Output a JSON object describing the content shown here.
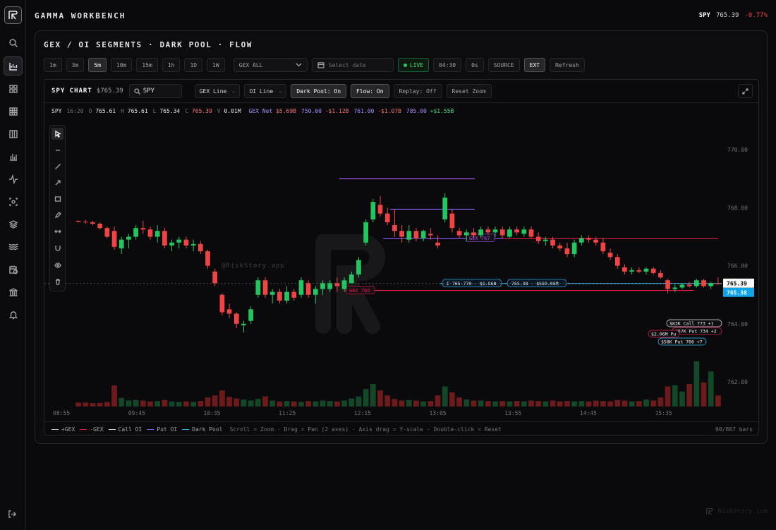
{
  "app": {
    "title": "GAMMA WORKBENCH"
  },
  "header_ticker": {
    "symbol": "SPY",
    "price": "765.39",
    "change": "-0.77%"
  },
  "panel": {
    "title": "GEX / OI SEGMENTS · DARK POOL · FLOW",
    "timeframes": [
      "1m",
      "3m",
      "5m",
      "10m",
      "15m",
      "1h",
      "1D",
      "1W"
    ],
    "active_timeframe": "5m",
    "gex_select": "GEX ALL",
    "date_placeholder": "Select date",
    "live_label": "LIVE",
    "clock": "04:30",
    "delay": "0s",
    "source_label": "SOURCE",
    "ext_label": "EXT",
    "refresh_label": "Refresh"
  },
  "chart_header": {
    "title": "SPY CHART",
    "price": "$765.39",
    "symbol_input": "SPY",
    "gex_mode": "GEX Line",
    "oi_mode": "OI  Line",
    "dark_pool": "Dark Pool: On",
    "flow": "Flow: On",
    "replay": "Replay: Off",
    "reset_zoom": "Reset Zoom"
  },
  "ohlc": {
    "symbol": "SPY",
    "time": "16:20",
    "o_label": "O",
    "o": "765.61",
    "h_label": "H",
    "h": "765.61",
    "l_label": "L",
    "l": "765.34",
    "c_label": "C",
    "c": "765.39",
    "v_label": "V",
    "v": "0.01M",
    "gex_label": "GEX Net",
    "gex_net": "$5.69B",
    "g1_strike": "750.00",
    "g1_val": "-$1.12B",
    "g2_strike": "761.00",
    "g2_val": "-$1.07B",
    "g3_strike": "785.00",
    "g3_val": "+$1.55B"
  },
  "watermark": "@RiskStory.app",
  "legend": {
    "items": [
      {
        "label": "+GEX",
        "color": "#d4d4d8"
      },
      {
        "label": "-GEX",
        "color": "#e11d48"
      },
      {
        "label": "Call OI",
        "color": "#e4e4e7"
      },
      {
        "label": "Put OI",
        "color": "#8b5cf6"
      },
      {
        "label": "Dark Pool",
        "color": "#38bdf8"
      }
    ],
    "hint": "Scroll = Zoom · Drag = Pan (2 axes) · Axis drag = Y-scale · Double-click = Reset",
    "bar_count": "90/887 bars"
  },
  "footer_brand": "RiskStory.com",
  "colors": {
    "up": "#22c55e",
    "down": "#ef4444",
    "gex_neg": "#e11d48",
    "put_oi": "#8b5cf6",
    "dark_pool": "#38bdf8"
  },
  "chart_data": {
    "type": "candlestick",
    "symbol": "SPY",
    "ylim": [
      761.2,
      771.0
    ],
    "y_ticks": [
      "770.00",
      "768.00",
      "766.00",
      "764.00",
      "762.00"
    ],
    "x_ticks": [
      "08:55",
      "09:45",
      "10:35",
      "11:25",
      "12:15",
      "13:05",
      "13:55",
      "14:45",
      "15:35"
    ],
    "candles": [
      [
        767.55,
        767.55,
        767.5,
        767.52
      ],
      [
        767.52,
        767.58,
        767.45,
        767.5
      ],
      [
        767.5,
        767.55,
        767.4,
        767.45
      ],
      [
        767.45,
        767.5,
        767.25,
        767.3
      ],
      [
        767.3,
        767.35,
        766.95,
        767.0
      ],
      [
        767.2,
        767.35,
        766.55,
        766.65
      ],
      [
        766.6,
        767.0,
        766.4,
        766.9
      ],
      [
        766.9,
        767.1,
        766.6,
        767.0
      ],
      [
        767.0,
        767.4,
        766.9,
        767.3
      ],
      [
        767.3,
        767.55,
        767.1,
        767.25
      ],
      [
        767.25,
        767.35,
        766.9,
        767.0
      ],
      [
        767.0,
        767.4,
        766.8,
        767.2
      ],
      [
        767.2,
        767.3,
        766.6,
        766.7
      ],
      [
        766.7,
        766.9,
        766.5,
        766.8
      ],
      [
        766.8,
        767.0,
        766.6,
        766.9
      ],
      [
        766.9,
        767.0,
        766.6,
        766.7
      ],
      [
        766.7,
        766.9,
        766.5,
        766.75
      ],
      [
        766.75,
        766.85,
        766.4,
        766.5
      ],
      [
        766.5,
        766.55,
        765.9,
        766.0
      ],
      [
        765.8,
        765.9,
        765.3,
        765.4
      ],
      [
        765.0,
        765.05,
        764.3,
        764.4
      ],
      [
        764.5,
        764.7,
        764.2,
        764.35
      ],
      [
        764.35,
        764.4,
        763.85,
        764.0
      ],
      [
        763.95,
        764.1,
        763.7,
        764.0
      ],
      [
        764.1,
        764.6,
        764.0,
        764.5
      ],
      [
        765.0,
        765.6,
        764.9,
        765.5
      ],
      [
        765.5,
        765.6,
        764.9,
        765.0
      ],
      [
        765.0,
        765.2,
        764.7,
        765.1
      ],
      [
        765.1,
        765.2,
        764.7,
        764.8
      ],
      [
        764.8,
        765.3,
        764.7,
        765.1
      ],
      [
        765.1,
        765.2,
        764.8,
        764.9
      ],
      [
        765.0,
        765.6,
        764.9,
        765.5
      ],
      [
        765.4,
        765.5,
        764.9,
        765.0
      ],
      [
        765.0,
        765.3,
        764.7,
        765.2
      ],
      [
        765.2,
        765.5,
        765.0,
        765.4
      ],
      [
        765.2,
        765.5,
        765.1,
        765.4
      ],
      [
        765.4,
        765.6,
        765.1,
        765.3
      ],
      [
        765.2,
        765.6,
        765.1,
        765.5
      ],
      [
        765.4,
        765.8,
        765.4,
        765.7
      ],
      [
        765.7,
        766.3,
        765.6,
        766.2
      ],
      [
        766.8,
        767.6,
        766.7,
        767.5
      ],
      [
        767.6,
        768.3,
        767.5,
        768.2
      ],
      [
        768.1,
        768.4,
        767.7,
        767.8
      ],
      [
        767.8,
        768.0,
        767.4,
        767.5
      ],
      [
        767.4,
        767.95,
        767.0,
        767.2
      ],
      [
        767.2,
        767.4,
        766.8,
        767.0
      ],
      [
        766.9,
        767.4,
        766.8,
        767.2
      ],
      [
        767.2,
        767.3,
        766.85,
        766.95
      ],
      [
        766.95,
        767.25,
        766.85,
        767.2
      ],
      [
        767.1,
        767.3,
        766.9,
        767.05
      ],
      [
        766.8,
        767.05,
        766.6,
        766.7
      ],
      [
        767.6,
        768.5,
        767.5,
        768.35
      ],
      [
        767.8,
        767.95,
        767.15,
        767.3
      ],
      [
        767.2,
        767.3,
        766.95,
        767.05
      ],
      [
        767.05,
        767.25,
        766.85,
        767.15
      ],
      [
        767.15,
        767.3,
        766.95,
        767.05
      ],
      [
        767.05,
        767.35,
        766.95,
        767.25
      ],
      [
        767.25,
        767.35,
        767.05,
        767.15
      ],
      [
        767.15,
        767.35,
        767.0,
        767.25
      ],
      [
        767.25,
        767.35,
        766.95,
        767.05
      ],
      [
        767.0,
        767.35,
        766.95,
        767.25
      ],
      [
        767.25,
        767.35,
        767.05,
        767.15
      ],
      [
        767.1,
        767.35,
        767.0,
        767.25
      ],
      [
        767.25,
        767.35,
        766.95,
        767.0
      ],
      [
        767.0,
        767.15,
        766.75,
        766.85
      ],
      [
        766.85,
        767.0,
        766.7,
        766.9
      ],
      [
        766.9,
        767.0,
        766.6,
        766.7
      ],
      [
        766.7,
        766.8,
        766.5,
        766.6
      ],
      [
        766.6,
        766.8,
        766.3,
        766.4
      ],
      [
        766.4,
        766.9,
        766.3,
        766.8
      ],
      [
        766.8,
        767.05,
        766.7,
        766.95
      ],
      [
        766.95,
        767.05,
        766.8,
        766.9
      ],
      [
        766.9,
        767.0,
        766.7,
        766.8
      ],
      [
        766.8,
        766.95,
        766.4,
        766.5
      ],
      [
        766.45,
        766.6,
        766.2,
        766.3
      ],
      [
        766.3,
        766.4,
        765.9,
        766.0
      ],
      [
        765.95,
        766.05,
        765.7,
        765.8
      ],
      [
        765.8,
        765.95,
        765.7,
        765.85
      ],
      [
        765.85,
        765.95,
        765.75,
        765.8
      ],
      [
        765.8,
        765.95,
        765.7,
        765.9
      ],
      [
        765.9,
        765.95,
        765.7,
        765.75
      ],
      [
        765.75,
        765.85,
        765.55,
        765.6
      ],
      [
        765.5,
        765.55,
        765.05,
        765.2
      ],
      [
        765.2,
        765.35,
        765.1,
        765.25
      ],
      [
        765.25,
        765.4,
        765.2,
        765.35
      ],
      [
        765.35,
        765.45,
        765.25,
        765.3
      ],
      [
        765.3,
        765.55,
        765.25,
        765.5
      ],
      [
        765.5,
        765.55,
        765.25,
        765.3
      ],
      [
        765.3,
        765.45,
        765.2,
        765.4
      ],
      [
        765.4,
        765.61,
        765.34,
        765.39
      ]
    ],
    "volume": [
      0.08,
      0.08,
      0.07,
      0.07,
      0.09,
      0.42,
      0.17,
      0.12,
      0.13,
      0.12,
      0.1,
      0.11,
      0.13,
      0.1,
      0.09,
      0.1,
      0.09,
      0.11,
      0.18,
      0.22,
      0.32,
      0.19,
      0.16,
      0.14,
      0.12,
      0.15,
      0.2,
      0.12,
      0.1,
      0.11,
      0.1,
      0.09,
      0.11,
      0.1,
      0.12,
      0.11,
      0.1,
      0.12,
      0.16,
      0.2,
      0.35,
      0.45,
      0.32,
      0.22,
      0.15,
      0.12,
      0.13,
      0.12,
      0.1,
      0.11,
      0.22,
      0.4,
      0.28,
      0.18,
      0.14,
      0.12,
      0.12,
      0.11,
      0.1,
      0.11,
      0.1,
      0.11,
      0.1,
      0.12,
      0.11,
      0.1,
      0.12,
      0.1,
      0.11,
      0.1,
      0.11,
      0.1,
      0.12,
      0.11,
      0.1,
      0.13,
      0.12,
      0.1,
      0.11,
      0.14,
      0.12,
      0.18,
      0.4,
      0.42,
      0.3,
      0.45,
      0.9,
      0.48,
      0.7,
      0.22
    ],
    "levels": [
      {
        "label": "GEX 765",
        "price": 765.15,
        "color": "#e11d48",
        "glow": true
      },
      {
        "label": "GEX 767",
        "price": 766.95,
        "color": "#8b5cf6"
      },
      {
        "label": "",
        "price": 766.95,
        "color": "#e11d48"
      },
      {
        "label": "",
        "price": 769.0,
        "color": "#a855f7",
        "glow": true
      },
      {
        "label": "",
        "price": 767.95,
        "color": "#8b5cf6"
      }
    ],
    "dark_pool_tags": [
      {
        "label": "Σ 765-770 · $1.86B",
        "price": 765.39
      },
      {
        "label": "765.38 · $569.06M",
        "price": 765.39
      }
    ],
    "flow_tags": [
      {
        "label": "$83K Call 773 +1"
      },
      {
        "label": "$67K Put 734 +2"
      },
      {
        "label": "$2.06M Pu"
      },
      {
        "label": "$58K Put 766 +7"
      }
    ],
    "last_price": "765.39",
    "dark_pool_price": "765.38"
  }
}
